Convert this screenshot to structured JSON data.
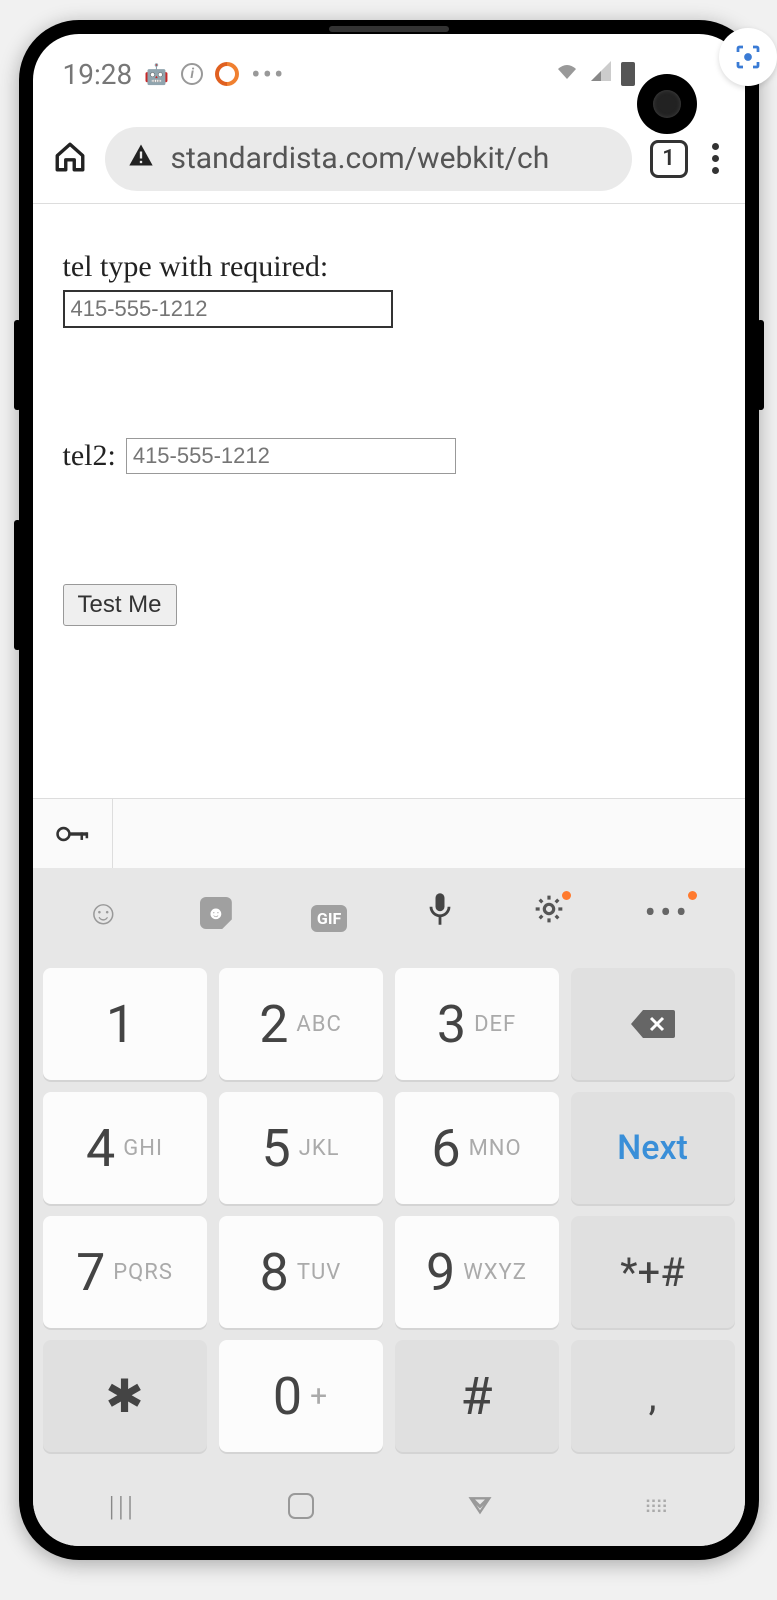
{
  "statusBar": {
    "time": "19:28",
    "icons": {
      "android": "android-icon",
      "info": "info-icon",
      "swirl": "swirl-icon",
      "dots": "dots-icon",
      "wifi": "wifi-icon",
      "cell": "cell-icon",
      "battery": "battery-icon"
    }
  },
  "browserBar": {
    "homeIcon": "home-icon",
    "securityIcon": "warning-triangle-icon",
    "url": "standardista.com/webkit/ch",
    "tabCount": "1",
    "menuIcon": "more-vert-icon"
  },
  "page": {
    "field1": {
      "label": "tel type with required:",
      "placeholder": "415-555-1212"
    },
    "field2": {
      "label": "tel2:",
      "placeholder": "415-555-1212"
    },
    "button": "Test Me"
  },
  "passwordBar": {
    "keyIcon": "key-icon"
  },
  "keyboardToolbar": {
    "emoji": "emoji-icon",
    "sticker": "sticker-icon",
    "gif": "GIF",
    "mic": "mic-icon",
    "settings": "gear-icon",
    "more": "more-horiz-icon"
  },
  "keypad": {
    "rows": [
      [
        {
          "digit": "1",
          "sub": ""
        },
        {
          "digit": "2",
          "sub": "ABC"
        },
        {
          "digit": "3",
          "sub": "DEF"
        },
        {
          "action": "backspace"
        }
      ],
      [
        {
          "digit": "4",
          "sub": "GHI"
        },
        {
          "digit": "5",
          "sub": "JKL"
        },
        {
          "digit": "6",
          "sub": "MNO"
        },
        {
          "action": "next",
          "label": "Next"
        }
      ],
      [
        {
          "digit": "7",
          "sub": "PQRS"
        },
        {
          "digit": "8",
          "sub": "TUV"
        },
        {
          "digit": "9",
          "sub": "WXYZ"
        },
        {
          "digit": "*+#",
          "sub": ""
        }
      ],
      [
        {
          "digit": "✱",
          "sub": ""
        },
        {
          "digit": "0",
          "sub": "+"
        },
        {
          "digit": "#",
          "sub": ""
        },
        {
          "digit": ",",
          "sub": ""
        }
      ]
    ]
  },
  "navBar": {
    "recents": "recents-icon",
    "home": "home-icon",
    "back": "back-icon",
    "kbToggle": "keyboard-icon"
  }
}
